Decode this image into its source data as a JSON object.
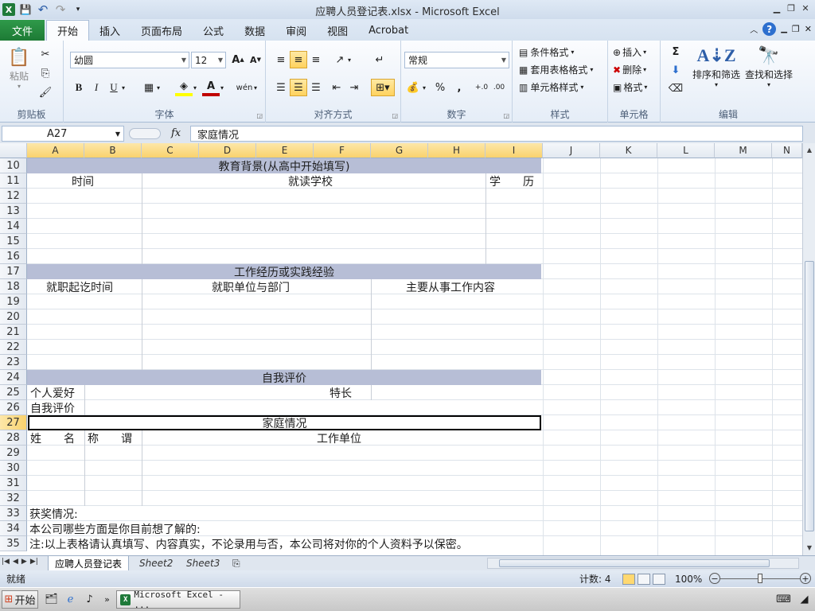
{
  "window": {
    "title": "应聘人员登记表.xlsx  -  Microsoft Excel",
    "qat_save": "💾",
    "qat_undo": "↶",
    "qat_redo": "↷"
  },
  "ribbon_tabs": {
    "file": "文件",
    "tabs": [
      "开始",
      "插入",
      "页面布局",
      "公式",
      "数据",
      "审阅",
      "视图",
      "Acrobat"
    ]
  },
  "clipboard": {
    "paste_label": "粘贴",
    "group_label": "剪贴板"
  },
  "font": {
    "font_name": "幼圆",
    "font_size": "12",
    "bold": "B",
    "italic": "I",
    "underline": "U",
    "grow": "A",
    "shrink": "A",
    "group_label": "字体",
    "font_color_accent": "#c00000",
    "fill_color_accent": "#ffff00"
  },
  "alignment": {
    "group_label": "对齐方式"
  },
  "number": {
    "format": "常规",
    "percent": "%",
    "comma": ",",
    "inc_decimal": "⁺.0\n.00",
    "dec_decimal": ".00\n→.0",
    "group_label": "数字"
  },
  "styles": {
    "conditional": "条件格式",
    "table_format": "套用表格格式",
    "cell_styles": "单元格样式",
    "group_label": "样式"
  },
  "cells": {
    "insert": "插入",
    "delete": "删除",
    "format": "格式",
    "group_label": "单元格"
  },
  "editing": {
    "sigma": "Σ",
    "sort_filter": "排序和筛选",
    "find_select": "查找和选择",
    "group_label": "编辑"
  },
  "formula_bar": {
    "name_box": "A27",
    "fx": "fx",
    "content": "家庭情况"
  },
  "columns": [
    "A",
    "B",
    "C",
    "D",
    "E",
    "F",
    "G",
    "H",
    "I",
    "J",
    "K",
    "L",
    "M",
    "N"
  ],
  "rows": [
    "10",
    "11",
    "12",
    "13",
    "14",
    "15",
    "16",
    "17",
    "18",
    "19",
    "20",
    "21",
    "22",
    "23",
    "24",
    "25",
    "26",
    "27",
    "28",
    "29",
    "30",
    "31",
    "32",
    "33",
    "34",
    "35"
  ],
  "sheet": {
    "edu_header": "教育背景(从高中开始填写)",
    "edu_time": "时间",
    "edu_school": "就读学校",
    "edu_degree": "学　　历",
    "work_header": "工作经历或实践经验",
    "work_time": "就职起讫时间",
    "work_unit": "就职单位与部门",
    "work_content": "主要从事工作内容",
    "self_header": "自我评价",
    "hobby": "个人爱好",
    "specialty": "特长",
    "self_eval": "自我评价",
    "family_header": "家庭情况",
    "family_name": "姓　　名",
    "family_title": "称　　谓",
    "family_work": "工作单位",
    "awards": "获奖情况:",
    "wish": "本公司哪些方面是你目前想了解的:",
    "note": "注:以上表格请认真填写、内容真实，不论录用与否，本公司将对你的个人资料予以保密。"
  },
  "sheet_tabs": [
    "应聘人员登记表",
    "Sheet2",
    "Sheet3"
  ],
  "status": {
    "ready": "就绪",
    "count": "计数: 4",
    "zoom": "100%"
  },
  "taskbar": {
    "start": "开始",
    "task": "Microsoft Excel - ..."
  }
}
